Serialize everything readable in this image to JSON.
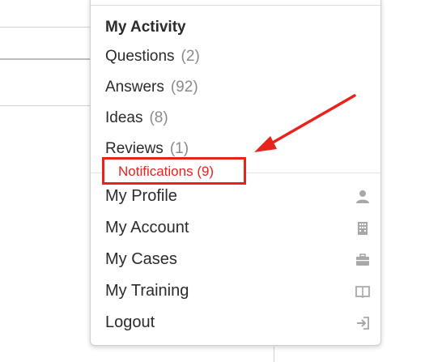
{
  "menu": {
    "section_title": "My Activity",
    "activity": [
      {
        "label": "Questions",
        "count": "(2)"
      },
      {
        "label": "Answers",
        "count": "(92)"
      },
      {
        "label": "Ideas",
        "count": "(8)"
      },
      {
        "label": "Reviews",
        "count": "(1)"
      }
    ],
    "notifications_label": "Notifications (9)",
    "links": [
      {
        "label": "My Profile",
        "icon": "user-icon"
      },
      {
        "label": "My Account",
        "icon": "building-icon"
      },
      {
        "label": "My Cases",
        "icon": "briefcase-icon"
      },
      {
        "label": "My Training",
        "icon": "book-icon"
      },
      {
        "label": "Logout",
        "icon": "logout-icon"
      }
    ]
  },
  "colors": {
    "annotation_red": "#e8231b",
    "text": "#2b2b2b",
    "count_gray": "#8a8a8a",
    "icon_gray": "#a8a8a8"
  }
}
